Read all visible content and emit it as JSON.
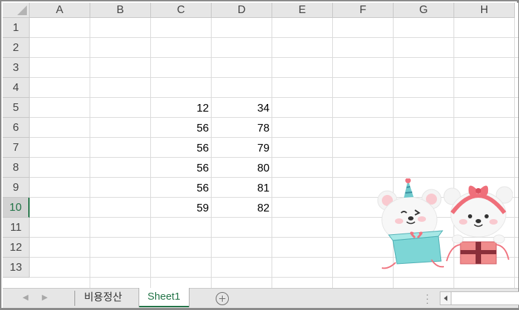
{
  "columns": [
    "A",
    "B",
    "C",
    "D",
    "E",
    "F",
    "G",
    "H"
  ],
  "rows": [
    "1",
    "2",
    "3",
    "4",
    "5",
    "6",
    "7",
    "8",
    "9",
    "10",
    "11",
    "12",
    "13"
  ],
  "active_row": "10",
  "cells": [
    {
      "row": "5",
      "col": "C",
      "value": "12"
    },
    {
      "row": "5",
      "col": "D",
      "value": "34"
    },
    {
      "row": "6",
      "col": "C",
      "value": "56"
    },
    {
      "row": "6",
      "col": "D",
      "value": "78"
    },
    {
      "row": "7",
      "col": "C",
      "value": "56"
    },
    {
      "row": "7",
      "col": "D",
      "value": "79"
    },
    {
      "row": "8",
      "col": "C",
      "value": "56"
    },
    {
      "row": "8",
      "col": "D",
      "value": "80"
    },
    {
      "row": "9",
      "col": "C",
      "value": "56"
    },
    {
      "row": "9",
      "col": "D",
      "value": "81"
    },
    {
      "row": "10",
      "col": "C",
      "value": "59"
    },
    {
      "row": "10",
      "col": "D",
      "value": "82"
    }
  ],
  "sheet_tabs": [
    {
      "label": "비용정산",
      "active": false
    },
    {
      "label": "Sheet1",
      "active": true
    }
  ],
  "icons": {
    "scroll_left": "triangle-left-icon",
    "scroll_right": "triangle-right-icon",
    "add_sheet": "plus-circle-icon",
    "options": "vertical-dots-icon",
    "picture": "bear-sticker-image"
  },
  "colors": {
    "accent": "#217346",
    "header_bg": "#e6e6e6",
    "gridline": "#dadada"
  }
}
